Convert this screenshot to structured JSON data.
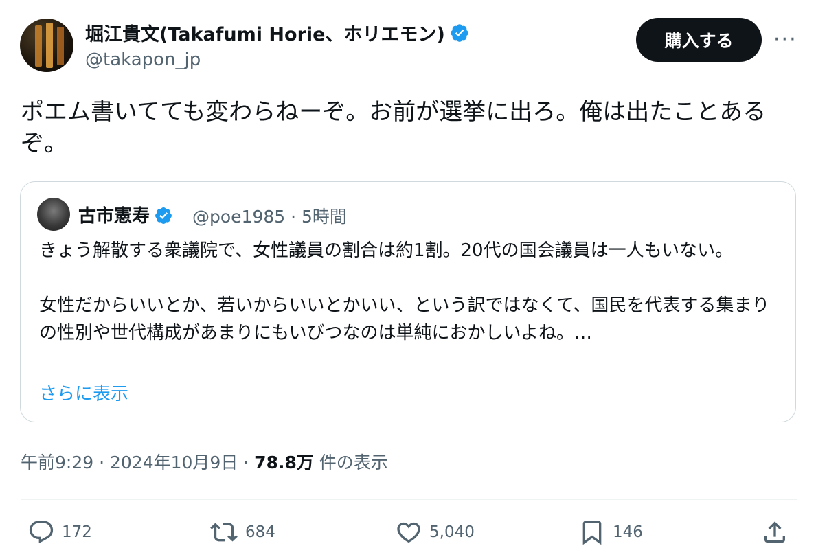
{
  "author": {
    "name": "堀江貴文(Takafumi Horie、ホリエモン)",
    "handle": "@takapon_jp"
  },
  "buy_button_label": "購入する",
  "more_label": "···",
  "tweet_text": "ポエム書いてても変わらねーぞ。お前が選挙に出ろ。俺は出たことあるぞ。",
  "quote": {
    "name": "古市憲寿",
    "handle_time": "@poe1985 · 5時間",
    "paragraphs": [
      "きょう解散する衆議院で、女性議員の割合は約1割。20代の国会議員は一人もいない。",
      "女性だからいいとか、若いからいいとかいい、という訳ではなくて、国民を代表する集まりの性別や世代構成があまりにもいびつなのは単純におかしいよね。…"
    ],
    "show_more": "さらに表示"
  },
  "meta": {
    "time_date": "午前9:29 · 2024年10月9日 · ",
    "views": "78.8万",
    "views_label": " 件の表示"
  },
  "actions": {
    "replies": "172",
    "retweets": "684",
    "likes": "5,040",
    "bookmarks": "146"
  },
  "colors": {
    "accent": "#1d9bf0",
    "text": "#0f1419",
    "secondary": "#536471",
    "border": "#cfd9de"
  },
  "icons": [
    "verified-badge-icon",
    "reply-icon",
    "retweet-icon",
    "like-icon",
    "bookmark-icon",
    "share-icon"
  ]
}
